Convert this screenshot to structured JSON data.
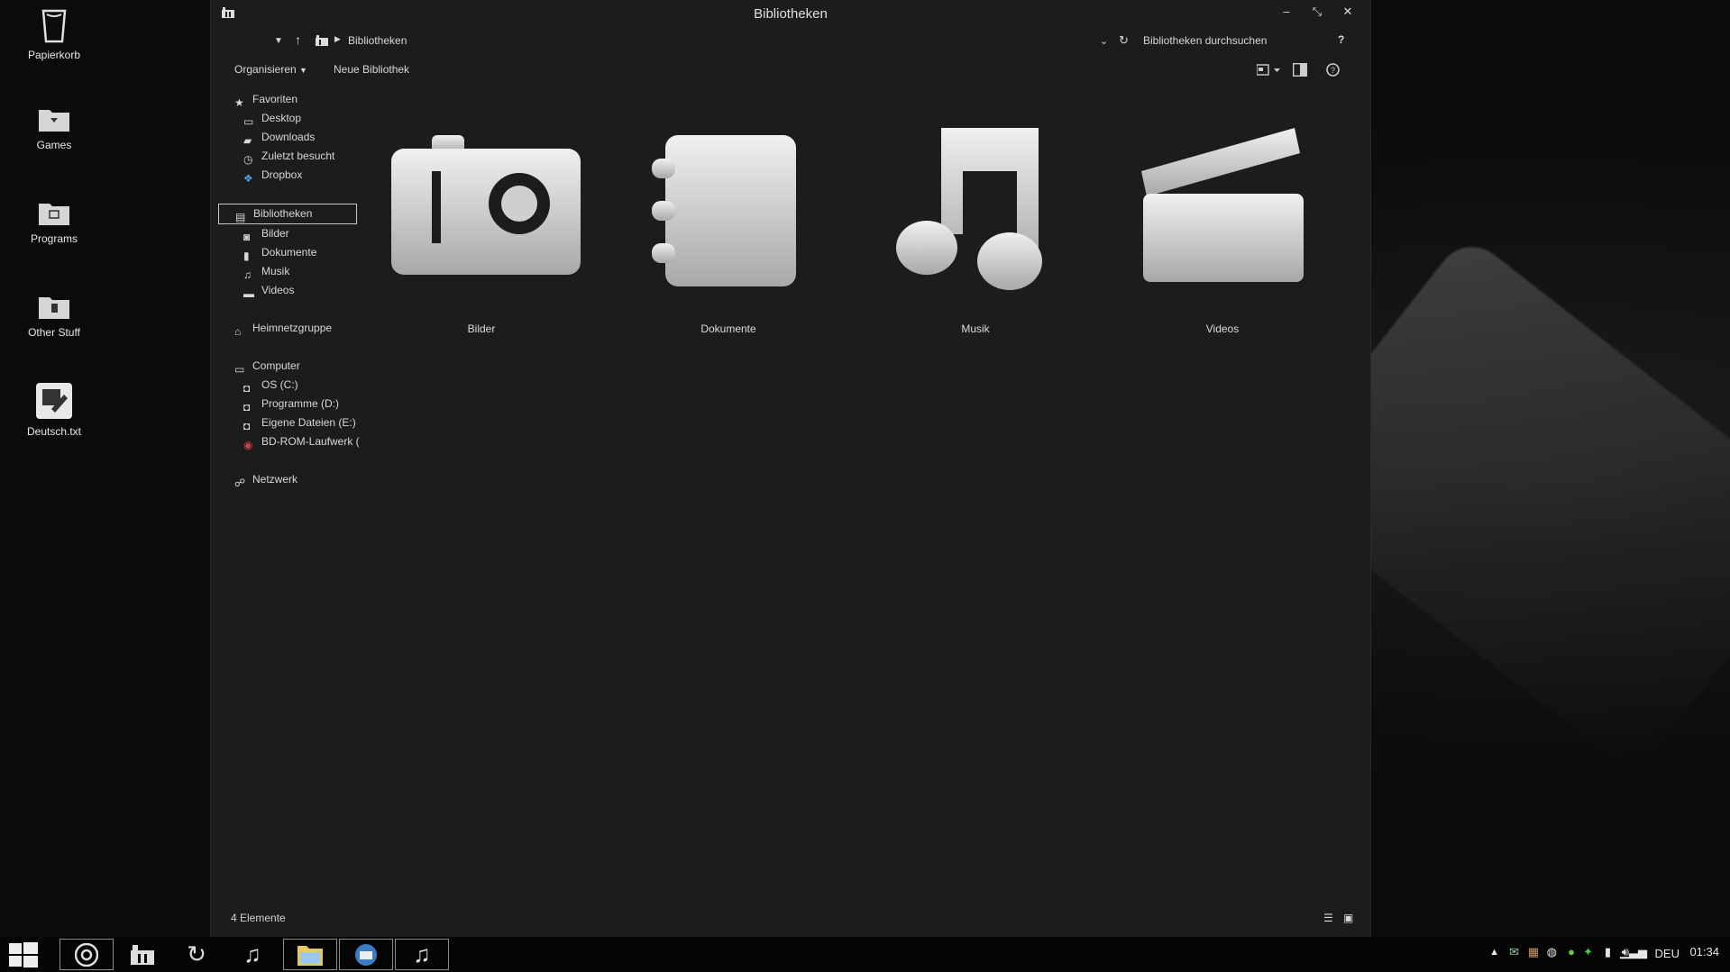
{
  "desktop": {
    "icons": [
      {
        "label": "Papierkorb",
        "icon": "recycle-bin-icon"
      },
      {
        "label": "Games",
        "icon": "folder-icon"
      },
      {
        "label": "Programs",
        "icon": "folder-icon"
      },
      {
        "label": "Other Stuff",
        "icon": "folder-icon"
      },
      {
        "label": "Deutsch.txt",
        "icon": "text-file-icon"
      }
    ]
  },
  "window": {
    "title": "Bibliotheken",
    "controls": {
      "minimize": "–",
      "maximize": "⤡",
      "close": "✕"
    },
    "address": {
      "breadcrumb": "Bibliotheken",
      "search_placeholder": "Bibliotheken durchsuchen",
      "help": "?"
    },
    "commands": {
      "organize": "Organisieren",
      "new_library": "Neue Bibliothek"
    },
    "nav": {
      "favorites": {
        "label": "Favoriten",
        "items": [
          "Desktop",
          "Downloads",
          "Zuletzt besucht",
          "Dropbox"
        ]
      },
      "libraries": {
        "label": "Bibliotheken",
        "items": [
          "Bilder",
          "Dokumente",
          "Musik",
          "Videos"
        ]
      },
      "homegroup": "Heimnetzgruppe",
      "computer": {
        "label": "Computer",
        "items": [
          "OS (C:)",
          "Programme (D:)",
          "Eigene Dateien (E:)",
          "BD-ROM-Laufwerk ("
        ]
      },
      "network": "Netzwerk"
    },
    "libraries": [
      {
        "label": "Bilder",
        "icon": "camera-icon"
      },
      {
        "label": "Dokumente",
        "icon": "notebook-icon"
      },
      {
        "label": "Musik",
        "icon": "music-note-icon"
      },
      {
        "label": "Videos",
        "icon": "clapperboard-icon"
      }
    ],
    "status": "4 Elemente"
  },
  "taskbar": {
    "language": "DEU",
    "time": "01:34"
  }
}
